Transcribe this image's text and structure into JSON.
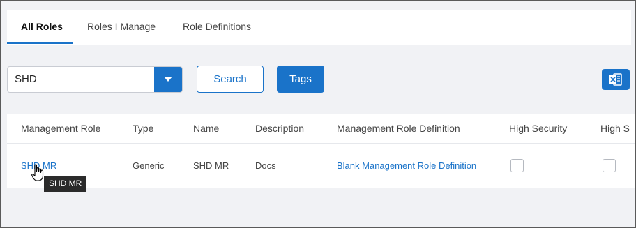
{
  "tabs": [
    {
      "label": "All Roles",
      "active": true
    },
    {
      "label": "Roles I Manage",
      "active": false
    },
    {
      "label": "Role Definitions",
      "active": false
    }
  ],
  "filter": {
    "selected_value": "SHD",
    "search_label": "Search",
    "tags_label": "Tags",
    "export_icon": "excel-icon"
  },
  "table": {
    "columns": [
      "Management Role",
      "Type",
      "Name",
      "Description",
      "Management Role Definition",
      "High Security",
      "High S"
    ],
    "rows": [
      {
        "management_role": "SHD MR",
        "type": "Generic",
        "name": "SHD MR",
        "description": "Docs",
        "definition": "Blank Management Role Definition",
        "high_security": false,
        "high_s": false
      }
    ]
  },
  "tooltip": "SHD MR",
  "colors": {
    "accent": "#1a73c9",
    "background": "#f1f2f5"
  }
}
